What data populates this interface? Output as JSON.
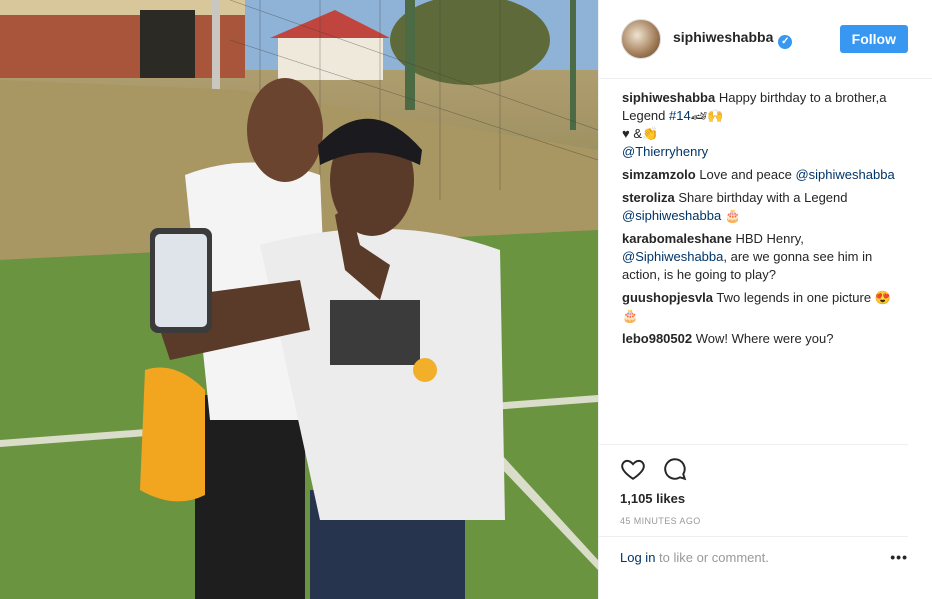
{
  "post": {
    "username": "siphiweshabba",
    "verified_icon": "verified-badge-icon",
    "follow_label": "Follow",
    "caption": {
      "user": "siphiweshabba",
      "text": "Happy birthday to a brother,a Legend",
      "hashtag": "#14",
      "emoji": "🏎🙌",
      "line2": "♥ &👏",
      "mention": "@Thierryhenry"
    },
    "comments": [
      {
        "user": "simzamzolo",
        "text": "Love and peace",
        "mention": "@siphiweshabba",
        "after": ""
      },
      {
        "user": "steroliza",
        "text": "Share birthday with a Legend",
        "mention": "@siphiweshabba",
        "after": " 🎂"
      },
      {
        "user": "karabomaleshane",
        "text": "HBD Henry,",
        "mention": "@Siphiweshabba",
        "after": ", are we gonna see him in action, is he going to play?"
      },
      {
        "user": "guushopjesvla",
        "text": "Two legends in one picture 😍 🎂",
        "mention": "",
        "after": ""
      },
      {
        "user": "lebo980502",
        "text": "Wow! Where were you?",
        "mention": "",
        "after": ""
      }
    ],
    "likes": "1,105 likes",
    "time": "45 MINUTES AGO",
    "login_link": "Log in",
    "login_suffix": "to like or comment.",
    "more_icon": "more-options-icon",
    "more_label": "•••"
  }
}
